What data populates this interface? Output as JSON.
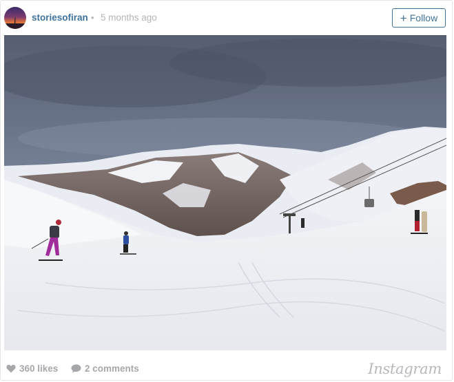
{
  "post": {
    "username": "storiesofiran",
    "separator": "•",
    "time_ago": "5 months ago",
    "follow_label": "Follow",
    "follow_icon": "plus-icon"
  },
  "photo": {
    "scene": "snowy-ski-slope-mountains"
  },
  "stats": {
    "likes_label": "360 likes",
    "comments_label": "2 comments",
    "like_icon": "heart-icon",
    "comment_icon": "speech-bubble-icon"
  },
  "brand": {
    "name": "Instagram"
  },
  "colors": {
    "accent": "#3f729b",
    "muted": "#a5a7aa"
  }
}
